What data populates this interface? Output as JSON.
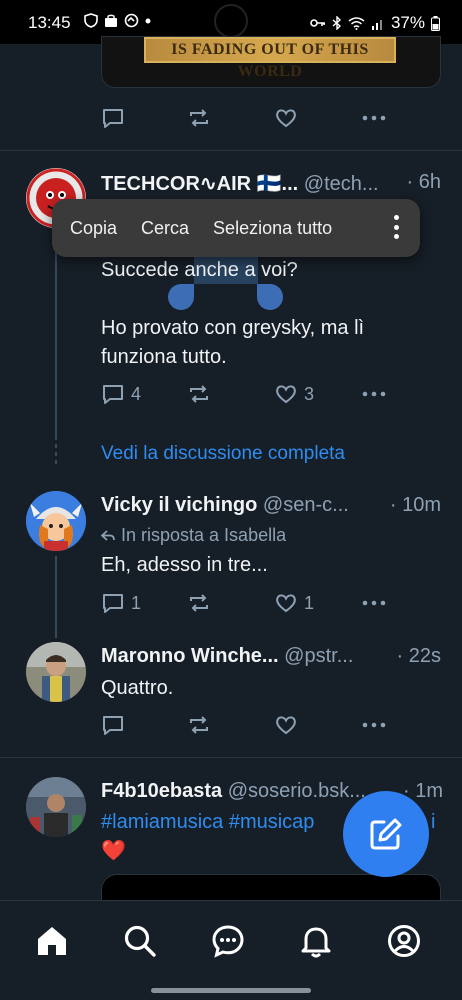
{
  "status": {
    "time": "13:45",
    "battery": "37%"
  },
  "embed": {
    "banner_text": "IS FADING OUT OF THIS WORLD"
  },
  "posts": [
    {
      "name": "TECHCOR∿AIR 🇫🇮...",
      "handle": "@tech...",
      "time": "· 6h",
      "text1": "Succede anche a voi?",
      "text2": "Ho provato con greysky, ma lì funziona tutto.",
      "replies": "4",
      "likes": "3"
    },
    {
      "name": "Vicky il vichingo",
      "handle": "@sen-c...",
      "time": "· 10m",
      "reply_to": "In risposta a Isabella",
      "text": "Eh, adesso in tre...",
      "replies": "1",
      "likes": "1"
    },
    {
      "name": "Maronno Winche...",
      "handle": "@pstr...",
      "time": "· 22s",
      "text": "Quattro."
    },
    {
      "name": "F4b10ebasta",
      "handle": "@soserio.bsk...",
      "time": "· 1m",
      "text": "#lamiamusica #musicap",
      "text_tail": "i",
      "emoji": "❤️"
    }
  ],
  "thread_link": "Vedi la discussione completa",
  "context_menu": {
    "copy": "Copia",
    "search": "Cerca",
    "select_all": "Seleziona tutto"
  },
  "colors": {
    "background": "#161e27",
    "accent": "#2f7ff0",
    "muted": "#8ea1b3",
    "link": "#2f8df0"
  },
  "icons": [
    "reply-icon",
    "repost-icon",
    "like-icon",
    "more-icon",
    "compose-icon",
    "home-icon",
    "search-icon",
    "chat-icon",
    "bell-icon",
    "profile-icon"
  ]
}
